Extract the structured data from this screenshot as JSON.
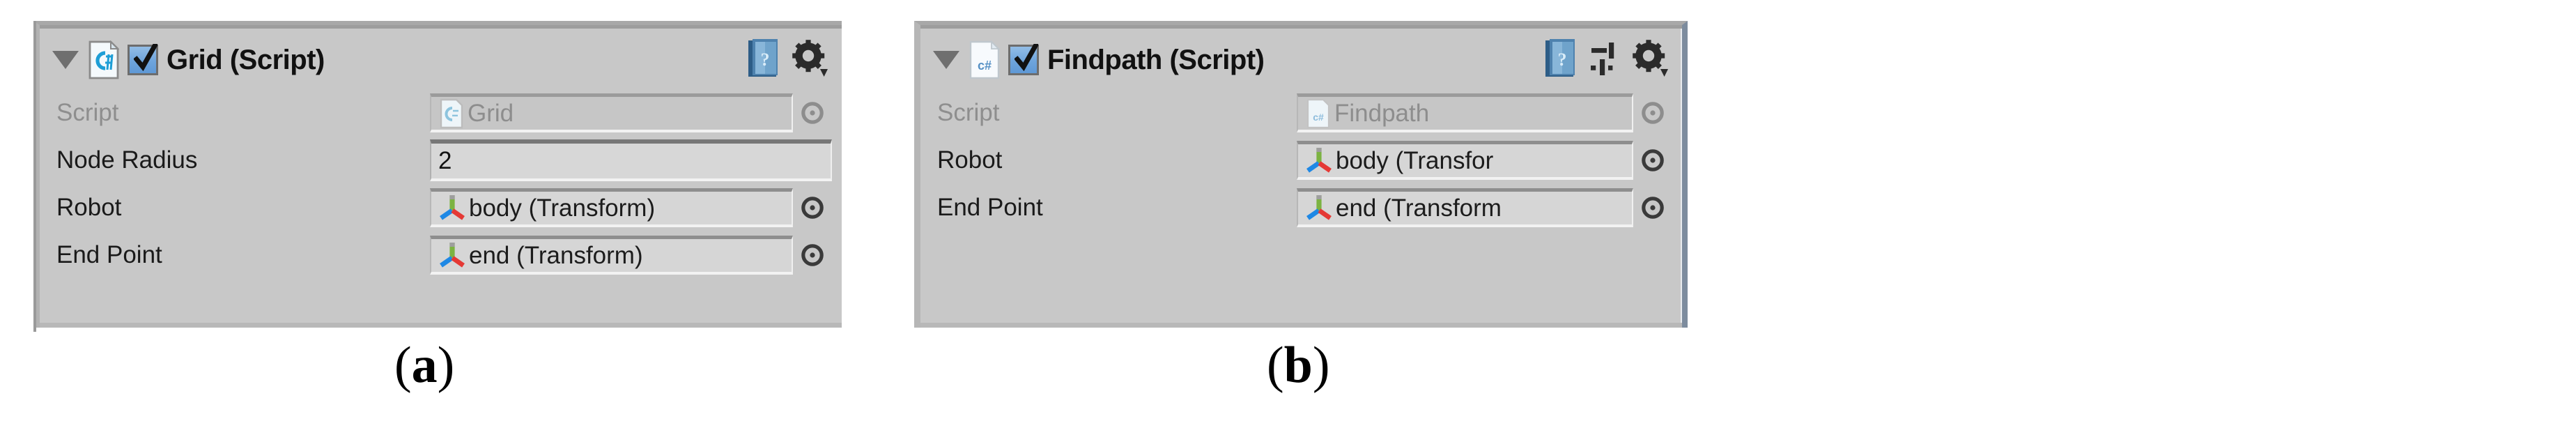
{
  "figure": {
    "panels": [
      {
        "id": "grid",
        "caption_open": "(",
        "caption_letter": "a",
        "caption_close": ")",
        "header": {
          "title": "Grid (Script)",
          "enabled_checkbox": true,
          "foldout_expanded": true,
          "script_icon": "csharp-script-icon",
          "help_icon": "help-book-icon",
          "gear_icon": "component-settings-gear-icon",
          "has_preset_icon": false
        },
        "properties": [
          {
            "label": "Script",
            "type": "object",
            "value": "Grid",
            "disabled": true,
            "icon": "csharp-script-icon",
            "has_picker": true
          },
          {
            "label": "Node Radius",
            "type": "number",
            "value": "2",
            "disabled": false,
            "has_picker": false
          },
          {
            "label": "Robot",
            "type": "object",
            "value": "body (Transform)",
            "disabled": false,
            "icon": "transform-gizmo-icon",
            "has_picker": true
          },
          {
            "label": "End Point",
            "type": "object",
            "value": "end (Transform)",
            "disabled": false,
            "icon": "transform-gizmo-icon",
            "has_picker": true
          }
        ]
      },
      {
        "id": "findpath",
        "caption_open": "(",
        "caption_letter": "b",
        "caption_close": ")",
        "header": {
          "title": "Findpath (Script)",
          "enabled_checkbox": true,
          "foldout_expanded": true,
          "script_icon": "csharp-script-icon",
          "help_icon": "help-book-icon",
          "preset_icon": "preset-sliders-icon",
          "gear_icon": "component-settings-gear-icon",
          "has_preset_icon": true
        },
        "properties": [
          {
            "label": "Script",
            "type": "object",
            "value": "Findpath",
            "disabled": true,
            "icon": "csharp-script-icon",
            "has_picker": true
          },
          {
            "label": "Robot",
            "type": "object",
            "value": "body (Transfor",
            "disabled": false,
            "icon": "transform-gizmo-icon",
            "has_picker": true
          },
          {
            "label": "End Point",
            "type": "object",
            "value": "end (Transform",
            "disabled": false,
            "icon": "transform-gizmo-icon",
            "has_picker": true
          }
        ]
      }
    ]
  },
  "colors": {
    "panel_background": "#c8c8c8",
    "checkbox_blue": "#6ea4dc",
    "help_icon_blue": "#3c6f9e",
    "gizmo_green": "#7cb342",
    "gizmo_red": "#e53935",
    "gizmo_blue": "#1e88e5",
    "disabled_text": "#8e8e8e",
    "label_text": "#1a1a1a",
    "panel_b_border": "#7d8c9e"
  }
}
